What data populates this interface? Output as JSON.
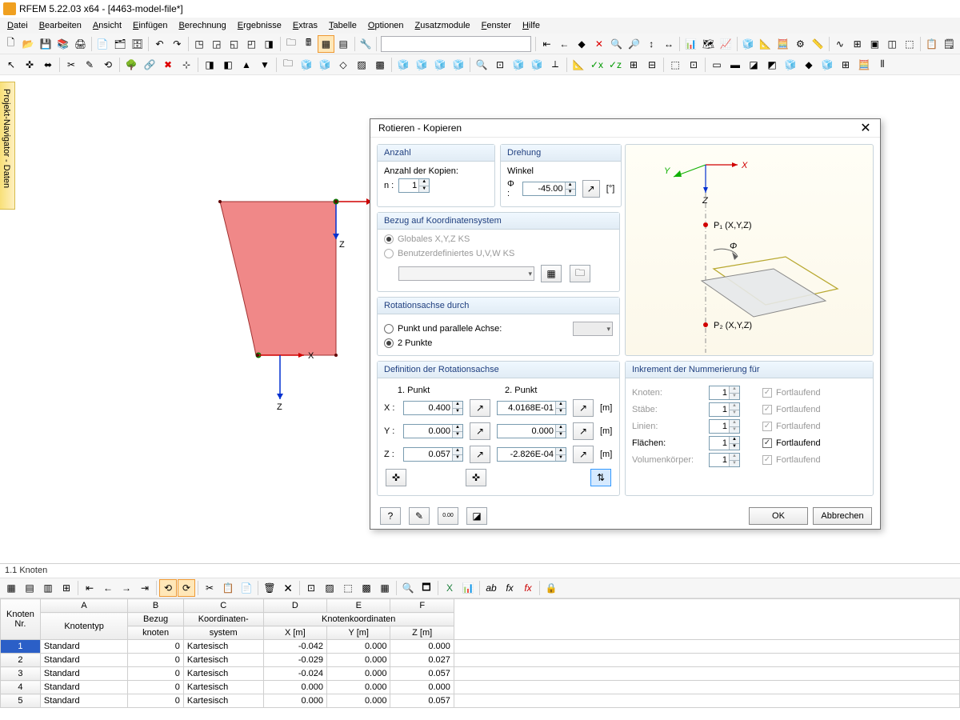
{
  "window": {
    "title": "RFEM 5.22.03 x64 - [4463-model-file*]"
  },
  "menus": [
    "Datei",
    "Bearbeiten",
    "Ansicht",
    "Einfügen",
    "Berechnung",
    "Ergebnisse",
    "Extras",
    "Tabelle",
    "Optionen",
    "Zusatzmodule",
    "Fenster",
    "Hilfe"
  ],
  "sidebar_tab": "Projekt-Navigator - Daten",
  "viewport": {
    "axes": {
      "x": "X",
      "z": "Z"
    }
  },
  "dialog": {
    "title": "Rotieren - Kopieren",
    "anzahl": {
      "header": "Anzahl",
      "copies_label": "Anzahl der Kopien:",
      "n_label": "n :",
      "n": "1"
    },
    "drehung": {
      "header": "Drehung",
      "angle_label": "Winkel",
      "phi_label": "Φ :",
      "phi": "-45.00",
      "unit": "[°]"
    },
    "koord": {
      "header": "Bezug auf Koordinatensystem",
      "opt_global": "Globales X,Y,Z KS",
      "opt_user": "Benutzerdefiniertes U,V,W KS"
    },
    "rotachse": {
      "header": "Rotationsachse durch",
      "opt_par": "Punkt und parallele Achse:",
      "opt_2p": "2 Punkte"
    },
    "def": {
      "header": "Definition der Rotationsachse",
      "p1": "1. Punkt",
      "p2": "2. Punkt",
      "x_label": "X :",
      "y_label": "Y :",
      "z_label": "Z :",
      "p1x": "0.400",
      "p1y": "0.000",
      "p1z": "0.057",
      "p2x": "4.0168E-01",
      "p2y": "0.000",
      "p2z": "-2.826E-04",
      "unit": "[m]"
    },
    "preview": {
      "x": "X",
      "y": "Y",
      "z": "Z",
      "phi": "Φ",
      "p1": "P₁ (X,Y,Z)",
      "p2": "P₂ (X,Y,Z)"
    },
    "incr": {
      "header": "Inkrement der Nummerierung für",
      "items": [
        {
          "label": "Knoten:",
          "val": "1",
          "cb": "Fortlaufend",
          "en": false
        },
        {
          "label": "Stäbe:",
          "val": "1",
          "cb": "Fortlaufend",
          "en": false
        },
        {
          "label": "Linien:",
          "val": "1",
          "cb": "Fortlaufend",
          "en": false
        },
        {
          "label": "Flächen:",
          "val": "1",
          "cb": "Fortlaufend",
          "en": true
        },
        {
          "label": "Volumenkörper:",
          "val": "1",
          "cb": "Fortlaufend",
          "en": false
        }
      ]
    },
    "ok": "OK",
    "cancel": "Abbrechen"
  },
  "table": {
    "title": "1.1 Knoten",
    "col_letters": [
      "A",
      "B",
      "C",
      "D",
      "E",
      "F"
    ],
    "headers_r1": {
      "knoten": "Knoten",
      "bezug": "Bezug",
      "koord": "Koordinaten-",
      "knotenkoord": "Knotenkoordinaten"
    },
    "headers_r2": {
      "nr": "Nr.",
      "typ": "Knotentyp",
      "bezug": "knoten",
      "system": "system",
      "x": "X [m]",
      "y": "Y [m]",
      "z": "Z [m]"
    },
    "rows": [
      {
        "n": "1",
        "typ": "Standard",
        "bezug": "0",
        "sys": "Kartesisch",
        "x": "-0.042",
        "y": "0.000",
        "z": "0.000"
      },
      {
        "n": "2",
        "typ": "Standard",
        "bezug": "0",
        "sys": "Kartesisch",
        "x": "-0.029",
        "y": "0.000",
        "z": "0.027"
      },
      {
        "n": "3",
        "typ": "Standard",
        "bezug": "0",
        "sys": "Kartesisch",
        "x": "-0.024",
        "y": "0.000",
        "z": "0.057"
      },
      {
        "n": "4",
        "typ": "Standard",
        "bezug": "0",
        "sys": "Kartesisch",
        "x": "0.000",
        "y": "0.000",
        "z": "0.000"
      },
      {
        "n": "5",
        "typ": "Standard",
        "bezug": "0",
        "sys": "Kartesisch",
        "x": "0.000",
        "y": "0.000",
        "z": "0.057"
      }
    ]
  }
}
